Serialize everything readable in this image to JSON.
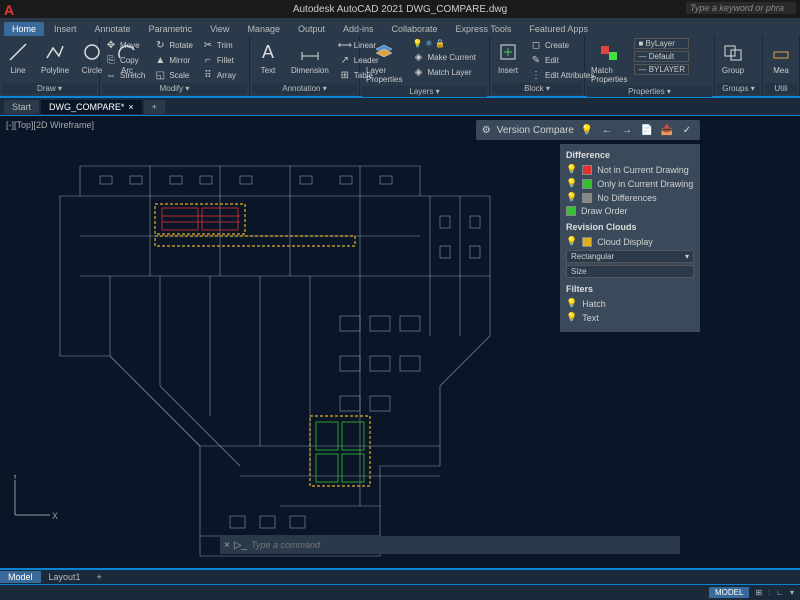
{
  "app": {
    "title": "Autodesk AutoCAD 2021   DWG_COMPARE.dwg",
    "search_placeholder": "Type a keyword or phra"
  },
  "menu": [
    "Home",
    "Insert",
    "Annotate",
    "Parametric",
    "View",
    "Manage",
    "Output",
    "Add-ins",
    "Collaborate",
    "Express Tools",
    "Featured Apps"
  ],
  "ribbon": {
    "active_tab": "Home",
    "draw": {
      "label": "Draw ▾",
      "line": "Line",
      "polyline": "Polyline",
      "circle": "Circle",
      "arc": "Arc"
    },
    "modify": {
      "label": "Modify ▾",
      "move": "Move",
      "copy": "Copy",
      "stretch": "Stretch",
      "rotate": "Rotate",
      "mirror": "Mirror",
      "scale": "Scale",
      "trim": "Trim",
      "fillet": "Fillet",
      "array": "Array"
    },
    "annotation": {
      "label": "Annotation ▾",
      "text": "Text",
      "dimension": "Dimension",
      "table": "Table",
      "linear": "Linear",
      "leader": "Leader"
    },
    "layers": {
      "label": "Layers ▾",
      "props": "Layer\nProperties",
      "make_current": "Make Current",
      "match_layer": "Match Layer"
    },
    "block": {
      "label": "Block ▾",
      "insert": "Insert",
      "create": "Create",
      "edit": "Edit",
      "attrs": "Edit Attributes"
    },
    "properties": {
      "label": "Properties ▾",
      "match": "Match\nProperties",
      "bylayer": "ByLayer",
      "default": "Default",
      "bylayer2": "BYLAYER"
    },
    "groups": {
      "label": "Groups ▾",
      "group": "Group"
    },
    "utilities": {
      "label": "Utili",
      "measure": "Mea"
    }
  },
  "doctabs": {
    "start": "Start",
    "file": "DWG_COMPARE*"
  },
  "viewcontrol": "[-][Top][2D Wireframe]",
  "vc_toolbar": {
    "label": "Version Compare"
  },
  "diff": {
    "heading": "Difference",
    "not_current": "Not in Current Drawing",
    "only_current": "Only in Current Drawing",
    "no_diff": "No Differences",
    "draw_order": "Draw Order",
    "rc_heading": "Revision Clouds",
    "cloud_display": "Cloud Display",
    "shape": "Rectangular",
    "size": "Size",
    "filters": "Filters",
    "hatch": "Hatch",
    "text": "Text"
  },
  "command": {
    "placeholder": "Type a command"
  },
  "layouts": {
    "model": "Model",
    "layout1": "Layout1",
    "plus": "+"
  },
  "status": {
    "model": "MODEL"
  }
}
